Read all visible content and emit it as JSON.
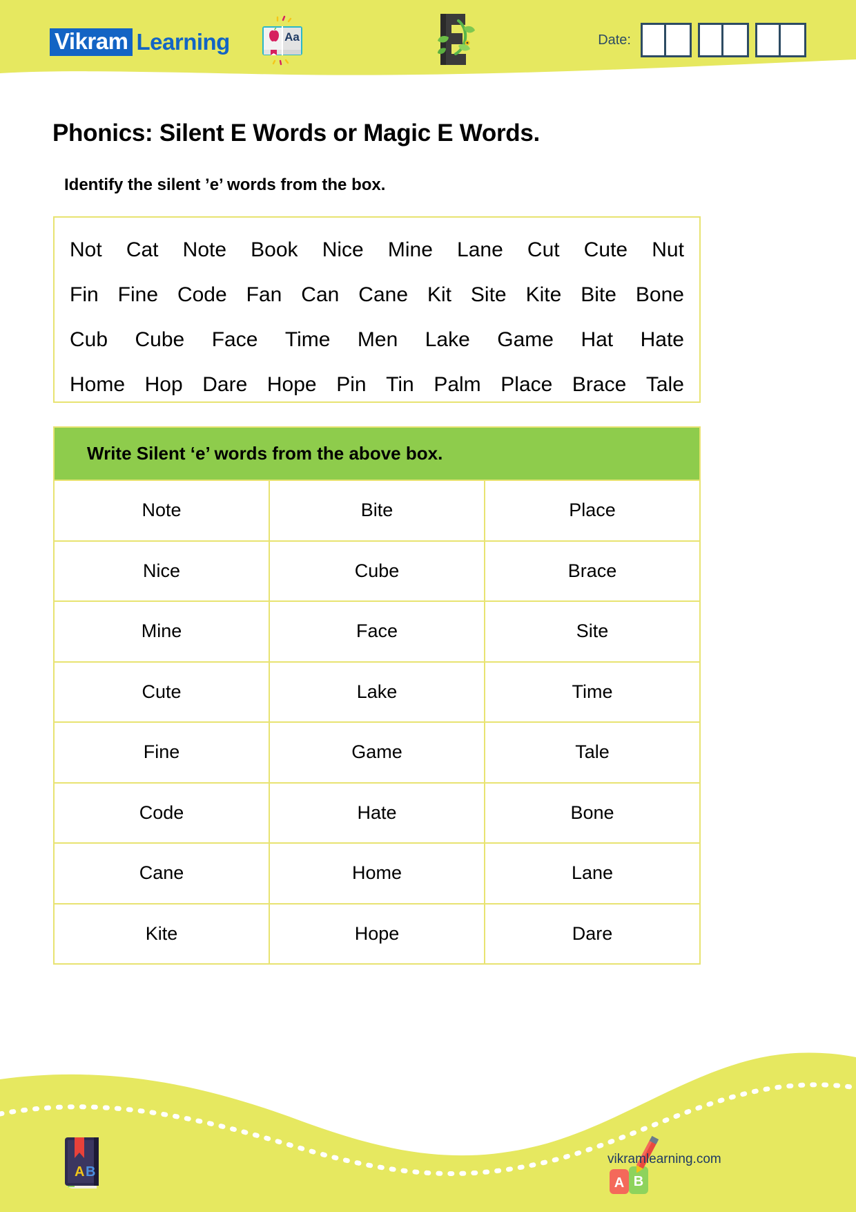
{
  "header": {
    "logo": {
      "part1": "Vikram",
      "part2": "Learning",
      "badge_color": "#1364c4"
    },
    "book_icon_name": "open-book-apple-abc-icon",
    "e_icon_name": "letter-e-plant-icon",
    "date_label": "Date:",
    "date_groups": 3,
    "date_cells_per_group": 2,
    "background_color": "#e6e860"
  },
  "title": "Phonics: Silent E Words or Magic E Words.",
  "subtitle": "Identify the silent ’e’ words from the box.",
  "wordbox": {
    "border_color": "#e8e371",
    "rows": [
      [
        "Not",
        "Cat",
        "Note",
        "Book",
        "Nice",
        "Mine",
        "Lane",
        "Cut",
        "Cute",
        "Nut"
      ],
      [
        "Fin",
        "Fine",
        "Code",
        "Fan",
        "Can",
        "Cane",
        "Kit",
        "Site",
        "Kite",
        "Bite",
        "Bone"
      ],
      [
        "Cub",
        "Cube",
        "Face",
        "Time",
        "Men",
        "Lake",
        "Game",
        "Hat",
        "Hate"
      ],
      [
        "Home",
        "Hop",
        "Dare",
        "Hope",
        "Pin",
        "Tin",
        "Palm",
        "Place",
        "Brace",
        "Tale"
      ]
    ]
  },
  "answer_table": {
    "header": "Write Silent ‘e’ words from the above box.",
    "header_color": "#8ecc4c",
    "border_color": "#e8e371",
    "rows": [
      [
        "Note",
        "Bite",
        "Place"
      ],
      [
        "Nice",
        "Cube",
        "Brace"
      ],
      [
        "Mine",
        "Face",
        "Site"
      ],
      [
        "Cute",
        "Lake",
        "Time"
      ],
      [
        "Fine",
        "Game",
        "Tale"
      ],
      [
        "Code",
        "Hate",
        "Bone"
      ],
      [
        "Cane",
        "Home",
        "Lane"
      ],
      [
        "Kite",
        "Hope",
        "Dare"
      ]
    ]
  },
  "footer": {
    "book_icon_name": "ab-book-pencil-icon",
    "blocks_icon_name": "ab-blocks-pencil-icon",
    "website": "vikramlearning.com",
    "wave_color": "#e6e860"
  }
}
